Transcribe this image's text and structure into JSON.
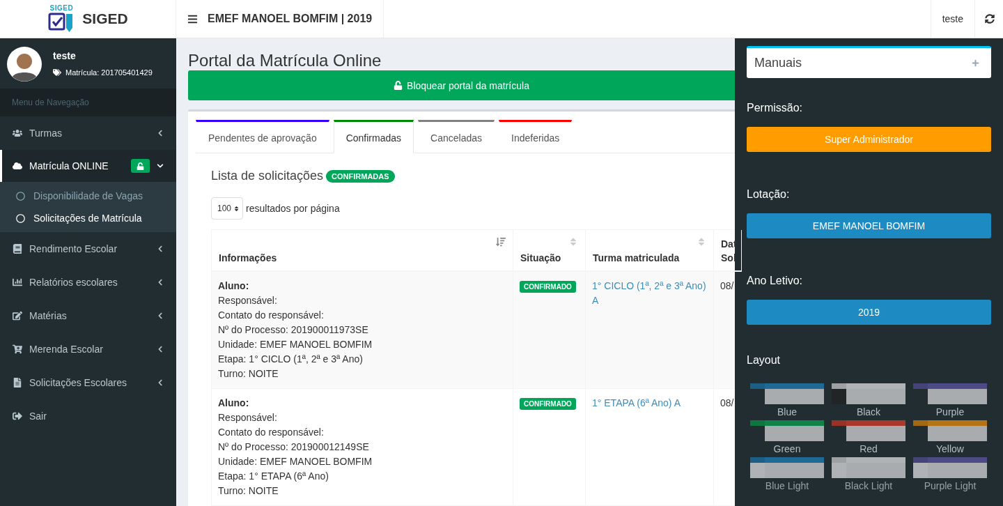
{
  "header": {
    "logo_mark": "SIGED",
    "brand": "SIGED",
    "title": "EMEF MANOEL BOMFIM | 2019",
    "user": "teste"
  },
  "sidebar": {
    "user": {
      "name": "teste",
      "registration": "Matrícula: 201705401429"
    },
    "section_title": "Menu de Navegação",
    "items": [
      {
        "label": "Turmas",
        "expanded": false,
        "selected": false
      },
      {
        "label": "Matrícula ONLINE",
        "expanded": true,
        "selected": true,
        "children": [
          {
            "label": "Disponibilidade de Vagas",
            "selected": false
          },
          {
            "label": "Solicitações de Matrícula",
            "selected": true
          }
        ]
      },
      {
        "label": "Rendimento Escolar",
        "expanded": false,
        "selected": false
      },
      {
        "label": "Relatórios escolares",
        "expanded": false,
        "selected": false
      },
      {
        "label": "Matérias",
        "expanded": false,
        "selected": false
      },
      {
        "label": "Merenda Escolar",
        "expanded": false,
        "selected": false
      },
      {
        "label": "Solicitações Escolares",
        "expanded": false,
        "selected": false
      },
      {
        "label": "Sair",
        "selected": false
      }
    ]
  },
  "page": {
    "title": "Portal da Matrícula Online",
    "lock_button": "Bloquear portal da matrícula",
    "tabs": [
      {
        "label": "Pendentes de aprovação",
        "color": "#3300ff",
        "selected": false
      },
      {
        "label": "Confirmadas",
        "color": "#008800",
        "selected": true
      },
      {
        "label": "Canceladas",
        "color": "#808080",
        "selected": false
      },
      {
        "label": "Indeferidas",
        "color": "#ff0000",
        "selected": false
      }
    ],
    "list_title": "Lista de solicitações",
    "list_badge": "CONFIRMADAS",
    "page_size": "100",
    "page_size_label": "resultados por página",
    "table": {
      "columns": [
        {
          "label": "Informações"
        },
        {
          "label": "Situação"
        },
        {
          "label": "Turma matriculada"
        },
        {
          "label": "Dat Sol"
        }
      ],
      "rows": [
        {
          "student_label": "Aluno:",
          "details": [
            "Responsável:",
            "Contato do responsável:",
            "Nº do Processo: 201900011973SE",
            "Unidade: EMEF MANOEL BOMFIM",
            "Etapa: 1° CICLO (1ª, 2ª e 3ª Ano)",
            "Turno: NOITE"
          ],
          "status": "CONFIRMADO",
          "class": "1° CICLO (1ª, 2ª e 3ª Ano) A",
          "date": "08/"
        },
        {
          "student_label": "Aluno:",
          "details": [
            "Responsável:",
            "Contato do responsável:",
            "Nº do Processo: 201900012149SE",
            "Unidade: EMEF MANOEL BOMFIM",
            "Etapa: 1° ETAPA (6ª Ano)",
            "Turno: NOITE"
          ],
          "status": "CONFIRMADO",
          "class": "1° ETAPA (6ª Ano) A",
          "date": "08/"
        }
      ]
    }
  },
  "control_panel": {
    "manuals": "Manuais",
    "permission_label": "Permissão:",
    "permission": "Super Administrador",
    "location_label": "Lotação:",
    "location": "EMEF MANOEL BOMFIM",
    "year_label": "Ano Letivo:",
    "year": "2019",
    "layout_label": "Layout",
    "skins": [
      {
        "label": "Blue",
        "color": "#1e6a95",
        "kind": "dark"
      },
      {
        "label": "Black",
        "color": "#b0b3b6",
        "kind": "black"
      },
      {
        "label": "Purple",
        "color": "#4e4a86",
        "kind": "dark"
      },
      {
        "label": "Green",
        "color": "#108448",
        "kind": "dark"
      },
      {
        "label": "Red",
        "color": "#a8392c",
        "kind": "dark"
      },
      {
        "label": "Yellow",
        "color": "#b47416",
        "kind": "dark"
      },
      {
        "label": "Blue Light",
        "color": "#1e6a95",
        "kind": "light"
      },
      {
        "label": "Black Light",
        "color": "#b0b3b6",
        "kind": "light"
      },
      {
        "label": "Purple Light",
        "color": "#4e4a86",
        "kind": "light"
      }
    ]
  }
}
